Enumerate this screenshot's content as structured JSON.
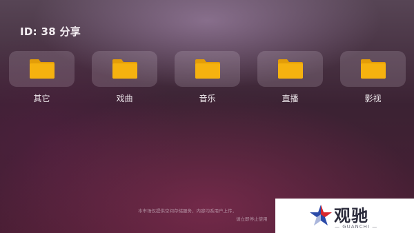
{
  "header": {
    "title": "ID: 38 分享"
  },
  "folders": [
    {
      "label": "其它",
      "icon": "folder-icon"
    },
    {
      "label": "戏曲",
      "icon": "folder-icon"
    },
    {
      "label": "音乐",
      "icon": "folder-icon"
    },
    {
      "label": "直播",
      "icon": "folder-icon"
    },
    {
      "label": "影视",
      "icon": "folder-icon"
    }
  ],
  "footer": {
    "line1": "本市场仅提供空间存储服务，内容均系用户上传，",
    "line2": "请立即停止使用"
  },
  "watermark": {
    "text": "观驰",
    "subtext": "— GUANCHI —"
  },
  "colors": {
    "folder": "#f5b20f",
    "folder_tab": "#e39d08",
    "card": "rgba(235,225,240,0.17)"
  }
}
